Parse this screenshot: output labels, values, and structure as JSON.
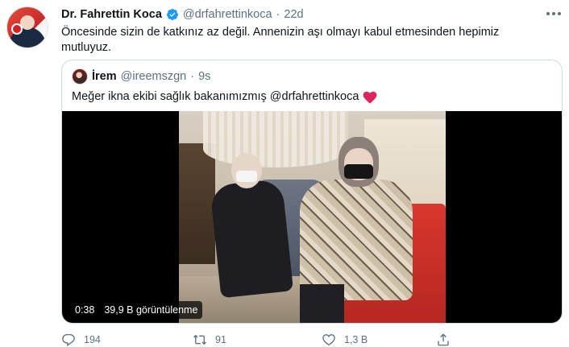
{
  "tweet": {
    "author": {
      "name": "Dr. Fahrettin Koca",
      "handle": "@drfahrettinkoca",
      "separator": "·",
      "time": "22d"
    },
    "text": "Öncesinde sizin de katkınız az değil. Annenizin aşı olmayı kabul etmesinden hepimiz mutluyuz.",
    "icons": {
      "verified": "verified-badge-icon",
      "more": "more-options-icon"
    },
    "accent_color": "#1d9bf0"
  },
  "quote": {
    "author": {
      "name": "İrem",
      "handle": "@ireemszgn",
      "separator": "·",
      "time": "9s"
    },
    "text": "Meğer ikna ekibi sağlık bakanımızmış @drfahrettinkoca",
    "heart_color": "#e0245e",
    "video": {
      "duration": "0:38",
      "views": "39,9 B görüntülenme"
    }
  },
  "actions": {
    "reply_count": "194",
    "retweet_count": "91",
    "like_count": "1,3 B",
    "icons": [
      "reply-icon",
      "retweet-icon",
      "like-icon",
      "share-icon"
    ]
  }
}
